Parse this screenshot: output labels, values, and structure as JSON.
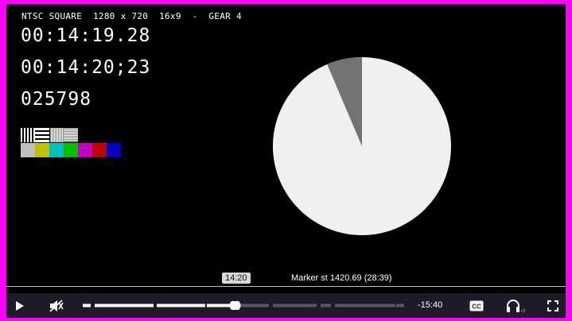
{
  "video": {
    "header": "NTSC SQUARE  1280 x 720  16x9  -  GEAR 4",
    "timecode_1": "00:14:19.28",
    "timecode_2": "00:14:20;23",
    "frame_count": "025798",
    "test_colors": [
      "#c0c0c0",
      "#c0c000",
      "#00c0c0",
      "#00c000",
      "#c000c0",
      "#c00000",
      "#0000c0"
    ],
    "pie": {
      "light_color": "#f0f0f0",
      "dark_color": "#737373",
      "dark_fraction": 0.064
    }
  },
  "timeline": {
    "hover_time": "14:20",
    "marker": "Marker st 1420.69 (28:39)"
  },
  "controls": {
    "play_icon": "play-icon",
    "mute_icon": "muted-speaker-icon",
    "progress_fraction": 0.474,
    "remaining": "-15:40",
    "cc_label": "CC",
    "audio_icon": "headphones-icon",
    "fullscreen_icon": "fullscreen-icon",
    "accent_color": "#ffffff"
  }
}
